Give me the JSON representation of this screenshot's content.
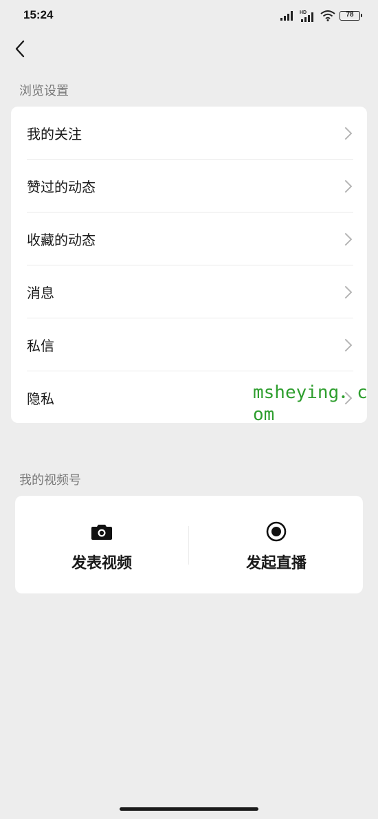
{
  "status_bar": {
    "time": "15:24",
    "battery": "78",
    "icons": [
      "signal-icon",
      "hd-signal-icon",
      "wifi-icon",
      "battery-icon"
    ]
  },
  "header": {
    "back_icon": "back-arrow-icon"
  },
  "browse_settings": {
    "title": "浏览设置",
    "items": [
      {
        "label": "我的关注"
      },
      {
        "label": "赞过的动态"
      },
      {
        "label": "收藏的动态"
      },
      {
        "label": "消息"
      },
      {
        "label": "私信"
      },
      {
        "label": "隐私"
      }
    ]
  },
  "my_channel": {
    "title": "我的视频号",
    "actions": [
      {
        "label": "发表视频",
        "icon": "camera-icon"
      },
      {
        "label": "发起直播",
        "icon": "live-record-icon"
      }
    ]
  },
  "watermark": {
    "text": "msheying．com",
    "color": "#2e9e2e"
  }
}
